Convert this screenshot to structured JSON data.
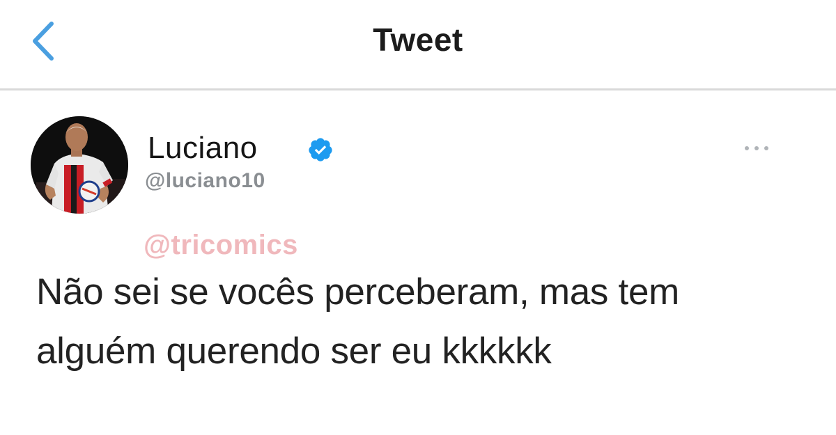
{
  "header": {
    "title": "Tweet",
    "back_icon": "chevron-left-icon",
    "accent_color": "#4a9fe0"
  },
  "tweet": {
    "author": {
      "display_name": "Luciano",
      "handle": "@luciano10",
      "verified": true,
      "verified_color": "#1d9bf0"
    },
    "more_icon": "more-horizontal-icon",
    "watermark": "@tricomics",
    "text_line_1": "Não sei se vocês perceberam, mas tem",
    "text_line_2": "alguém querendo ser eu kkkkkk"
  }
}
